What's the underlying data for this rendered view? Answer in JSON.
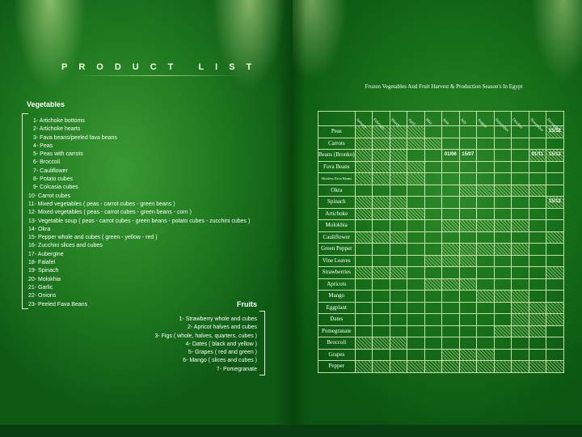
{
  "left": {
    "title": "PRODUCT LIST",
    "vegetables_heading": "Vegetables",
    "vegetables": [
      "1- Artichoke bottoms",
      "2- Artichoke hearts",
      "3- Fava beans/peeled fava beans",
      "4- Peas",
      "5- Peas with carrots",
      "6- Broccoli",
      "7- Cauliflower",
      "8- Potato cubes",
      "9- Colcasia cubes",
      "10- Carrot cubes",
      "11- Mixed vegetables ( peas - carrot cubes - green beans )",
      "12- Mixed vegetables ( peas - carrot cubes - green beans - corn )",
      "13- Vegetable soup ( peas - carrot cubes - green beans - potato cubes - zucchini cubes )",
      "14- Okra",
      "15- Pepper whole and cubes ( green - yellow - red )",
      "16- Zucchini slices and cubes",
      "17- Aubergine",
      "18- Falafel",
      "19- Spinach",
      "20- Molokhia",
      "21- Garlic",
      "22- Onions",
      "23- Peeled Fava Beans"
    ],
    "fruits_heading": "Fruits",
    "fruits": [
      "1- Strawberry whole and cubes",
      "2- Apricot halves and cubes",
      "3- Figs ( whole, halves, quarters, cubes )",
      "4- Dates ( black and yellow )",
      "5- Grapes ( red and green )",
      "6- Mango ( slices and cubes )",
      "7- Pomegranate"
    ]
  },
  "right": {
    "title": "Frozen Vegetables And Fruit Harvest & Production Season's In Egypt",
    "months": [
      "January",
      "February",
      "March",
      "April",
      "May",
      "June",
      "July",
      "August",
      "September",
      "October",
      "November",
      "December"
    ],
    "rows": [
      {
        "name": "Peas",
        "season": [
          1,
          1,
          1,
          1,
          0,
          0,
          0,
          0,
          0,
          0,
          0,
          1
        ],
        "dates": {
          "11": "15/12"
        }
      },
      {
        "name": "Carrots",
        "season": [
          1,
          1,
          1,
          1,
          1,
          0,
          0,
          0,
          0,
          0,
          0,
          0
        ],
        "dates": {}
      },
      {
        "name": "Beans (Bronko)",
        "season": [
          1,
          1,
          1,
          0,
          0,
          0,
          0,
          0,
          0,
          0,
          1,
          1
        ],
        "dates": {
          "5": "01/06",
          "6": "15/07",
          "10": "01/11",
          "11": "15/12"
        }
      },
      {
        "name": "Fava Beans",
        "season": [
          1,
          1,
          1,
          1,
          0,
          0,
          0,
          0,
          0,
          0,
          0,
          0
        ],
        "dates": {}
      },
      {
        "name": "Skinless Fava Beans",
        "season": [
          1,
          1,
          1,
          1,
          0,
          0,
          0,
          0,
          0,
          0,
          0,
          0
        ],
        "dates": {}
      },
      {
        "name": "Okra",
        "season": [
          0,
          0,
          0,
          0,
          0,
          0,
          1,
          1,
          1,
          1,
          1,
          0
        ],
        "dates": {}
      },
      {
        "name": "Spinach",
        "season": [
          1,
          1,
          1,
          0,
          0,
          0,
          0,
          0,
          0,
          0,
          0,
          1
        ],
        "dates": {
          "11": "15/12"
        }
      },
      {
        "name": "Artichoke",
        "season": [
          1,
          1,
          1,
          1,
          0,
          0,
          0,
          0,
          0,
          0,
          0,
          0
        ],
        "dates": {}
      },
      {
        "name": "Molokhia",
        "season": [
          0,
          0,
          0,
          0,
          0,
          1,
          1,
          1,
          1,
          1,
          0,
          0
        ],
        "dates": {}
      },
      {
        "name": "Cauliflower",
        "season": [
          1,
          1,
          1,
          0,
          0,
          0,
          0,
          0,
          0,
          0,
          0,
          1
        ],
        "dates": {}
      },
      {
        "name": "Green Pepper",
        "season": [
          0,
          0,
          0,
          0,
          0,
          1,
          1,
          1,
          1,
          1,
          0,
          0
        ],
        "dates": {}
      },
      {
        "name": "Vine Leaves",
        "season": [
          0,
          0,
          0,
          0,
          1,
          1,
          1,
          0,
          0,
          0,
          0,
          0
        ],
        "dates": {}
      },
      {
        "name": "Strawberries",
        "season": [
          1,
          1,
          1,
          0,
          0,
          0,
          0,
          0,
          0,
          0,
          0,
          1
        ],
        "dates": {}
      },
      {
        "name": "Apricots",
        "season": [
          0,
          0,
          0,
          0,
          1,
          1,
          1,
          0,
          0,
          0,
          0,
          0
        ],
        "dates": {}
      },
      {
        "name": "Mango",
        "season": [
          0,
          0,
          0,
          0,
          0,
          0,
          0,
          1,
          1,
          1,
          0,
          0
        ],
        "dates": {}
      },
      {
        "name": "Eggplant",
        "season": [
          0,
          0,
          0,
          0,
          0,
          0,
          0,
          0,
          0,
          1,
          1,
          1
        ],
        "dates": {}
      },
      {
        "name": "Dates",
        "season": [
          0,
          0,
          0,
          0,
          0,
          0,
          0,
          0,
          0,
          1,
          1,
          1
        ],
        "dates": {}
      },
      {
        "name": "Pomegranate",
        "season": [
          0,
          0,
          0,
          0,
          0,
          0,
          0,
          0,
          1,
          1,
          1,
          0
        ],
        "dates": {}
      },
      {
        "name": "Broccoli",
        "season": [
          1,
          1,
          1,
          0,
          0,
          0,
          0,
          0,
          0,
          0,
          0,
          0
        ],
        "dates": {}
      },
      {
        "name": "Grapes",
        "season": [
          0,
          0,
          0,
          0,
          0,
          1,
          1,
          1,
          0,
          0,
          0,
          0
        ],
        "dates": {}
      },
      {
        "name": "Pepper",
        "season": [
          1,
          1,
          1,
          1,
          1,
          1,
          1,
          1,
          1,
          1,
          1,
          1
        ],
        "dates": {}
      }
    ]
  }
}
